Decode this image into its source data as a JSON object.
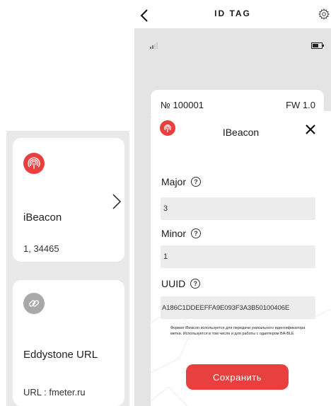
{
  "colors": {
    "accent": "#e8403f",
    "muted_icon": "#a8a8a8",
    "panel_bg": "#e9e9e9",
    "device_bg": "#e4e4e4",
    "input_bg": "#ececec"
  },
  "left_cards": [
    {
      "icon": "beacon-signal-icon",
      "title": "iBeacon",
      "subtitle": "1, 34465"
    },
    {
      "icon": "link-icon",
      "title": "Eddystone URL",
      "subtitle": "URL : fmeter.ru"
    }
  ],
  "topbar": {
    "title": "ID TAG"
  },
  "device_info": {
    "number": "№ 100001",
    "firmware": "FW 1.0"
  },
  "modal": {
    "title": "IBeacon",
    "fields": {
      "major": {
        "label": "Major",
        "value": "3"
      },
      "minor": {
        "label": "Minor",
        "value": "1"
      },
      "uuid": {
        "label": "UUID",
        "value": "A186C1DDEEFFA9E093F3A3B50100406E"
      }
    },
    "help_glyph": "?",
    "note": "Формат iBeacon используется для передачи уникального идентификатора метки. Используется в том числе и для работы с одаптером BA-BLE",
    "save_label": "Сохранить"
  }
}
